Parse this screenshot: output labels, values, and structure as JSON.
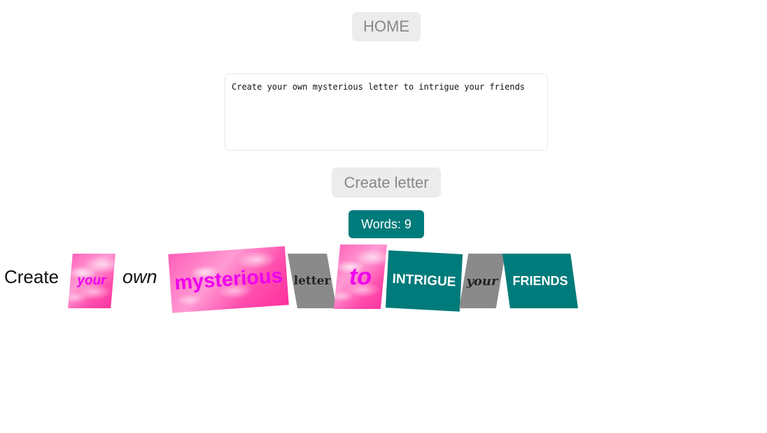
{
  "nav": {
    "home_label": "HOME"
  },
  "editor": {
    "value": "Create your own mysterious letter to intrigue your friends"
  },
  "actions": {
    "create_label": "Create letter"
  },
  "stats": {
    "words_label": "Words: 9"
  },
  "letter": {
    "words": [
      "Create",
      "your",
      "own",
      "mysterious",
      "letter",
      "to",
      "INTRIGUE",
      "your",
      "FRIENDS"
    ]
  },
  "colors": {
    "teal": "#007b7b",
    "magenta": "#ee00ee",
    "gray_tile": "#8a8a8a",
    "button_bg": "#ececec"
  }
}
